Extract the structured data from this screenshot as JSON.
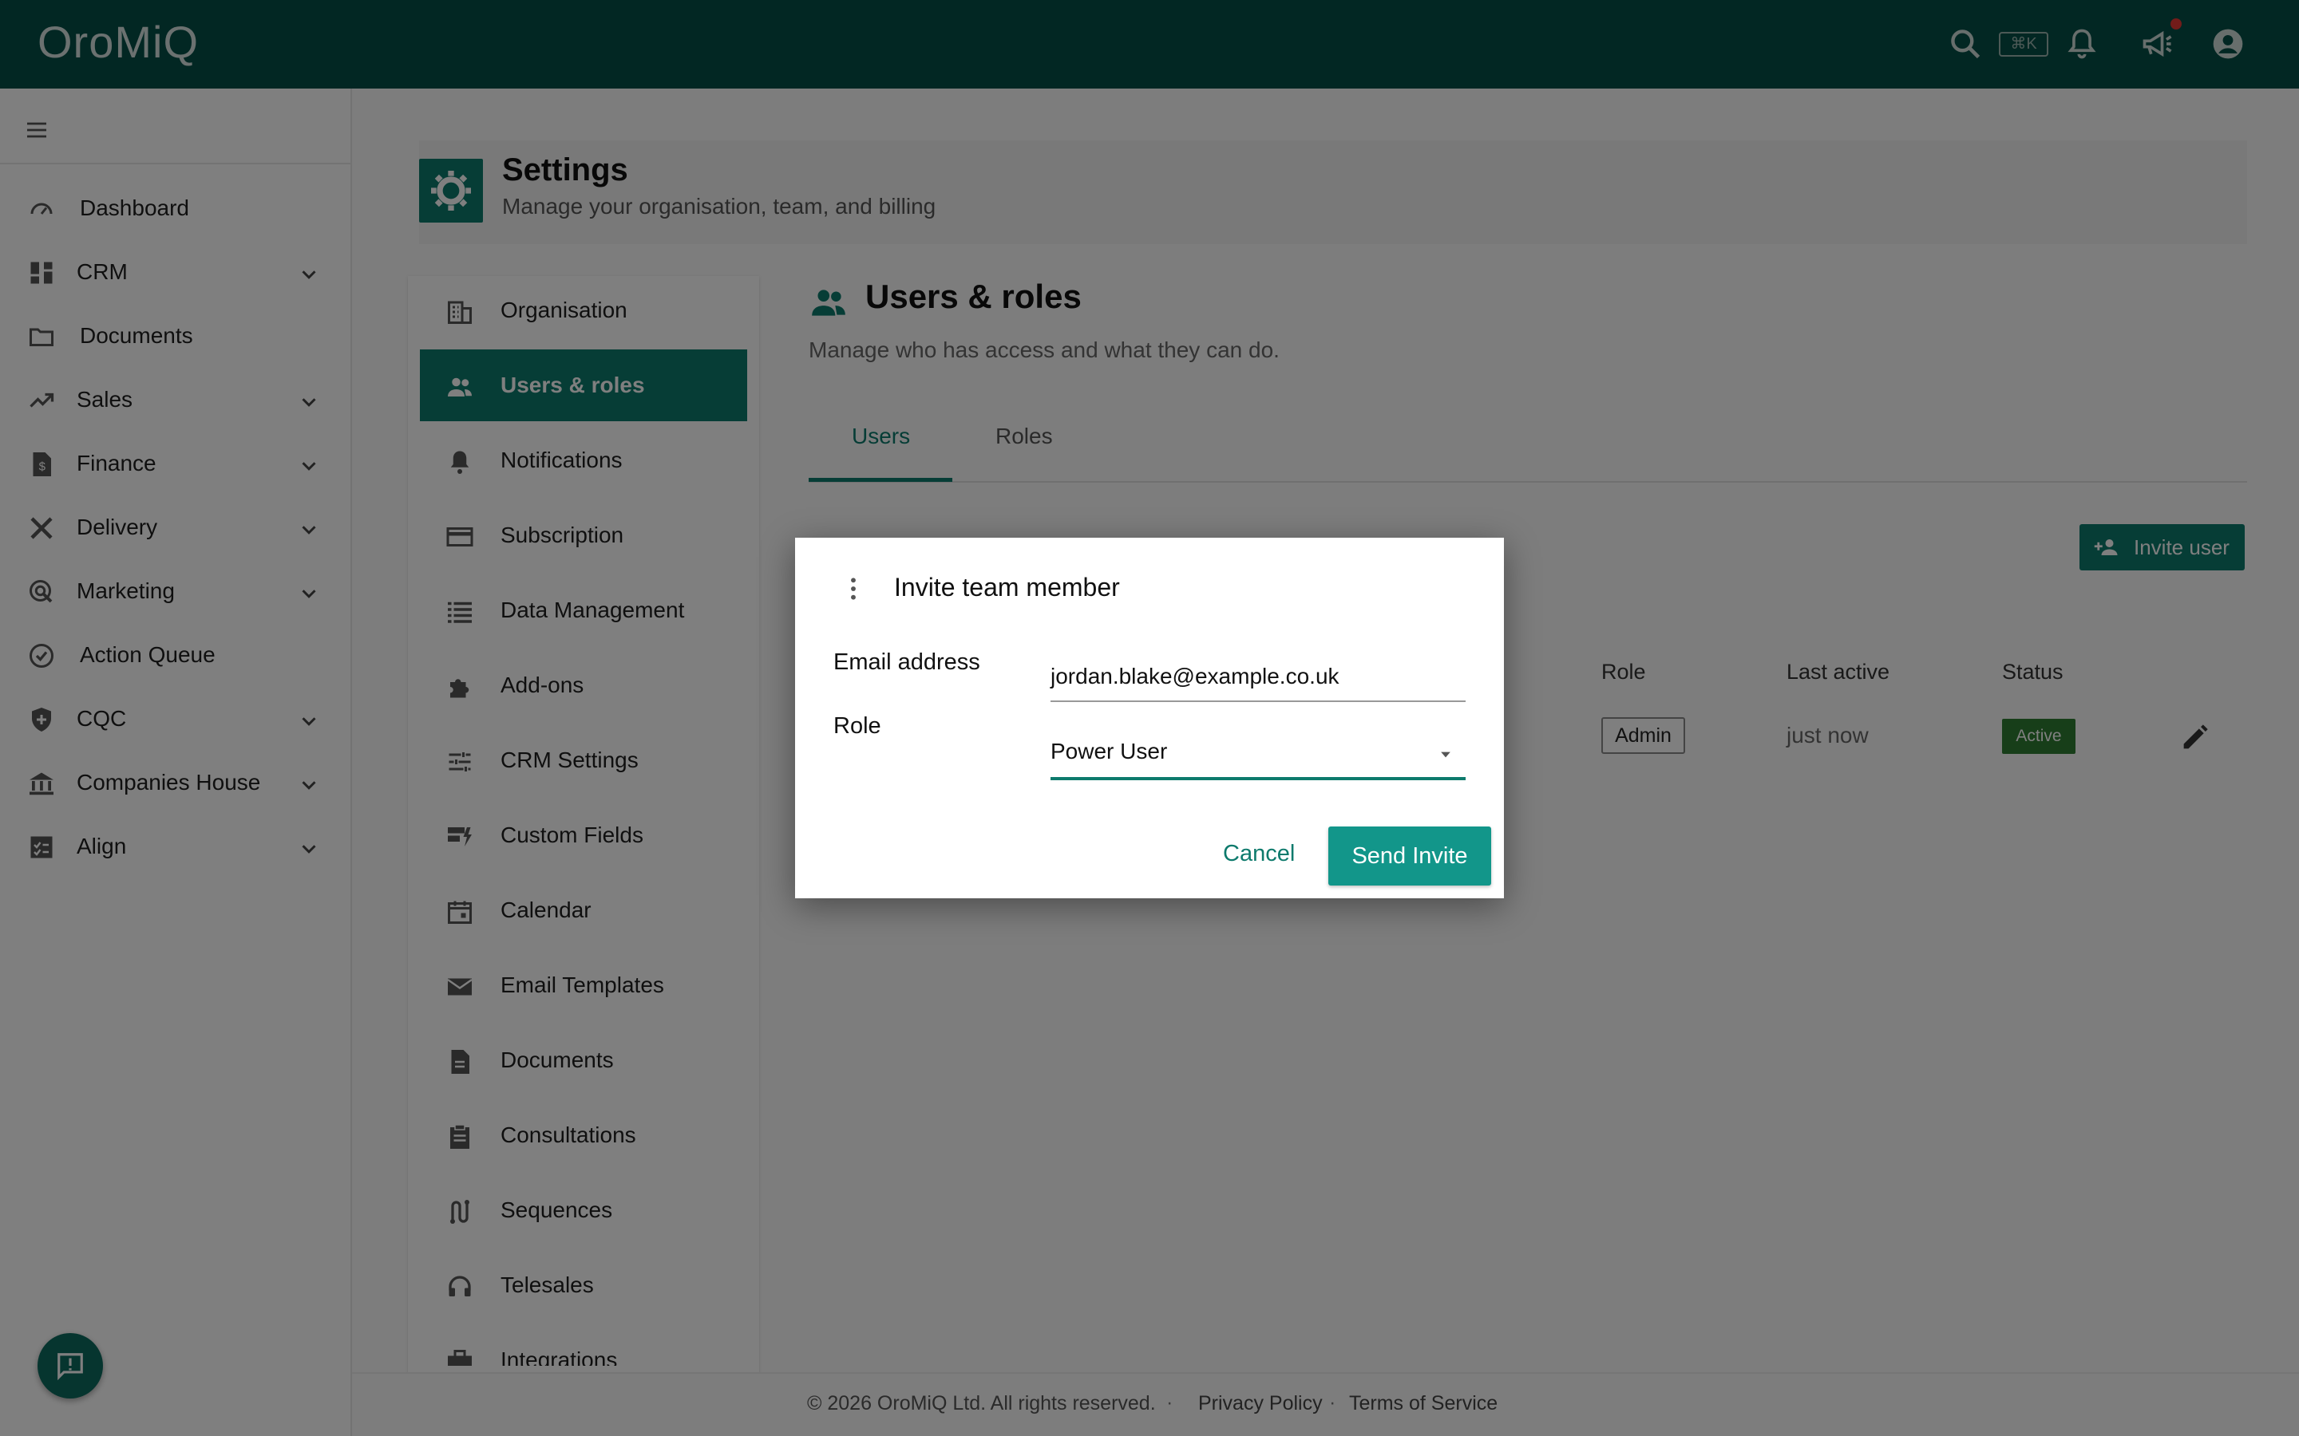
{
  "app": {
    "logo": "OroMiQ",
    "search_shortcut": "⌘K"
  },
  "sidebar": {
    "items": [
      {
        "label": "Dashboard",
        "icon": "speedometer-icon",
        "expandable": false
      },
      {
        "label": "CRM",
        "icon": "dashboard-grid-icon",
        "expandable": true
      },
      {
        "label": "Documents",
        "icon": "folder-icon",
        "expandable": false
      },
      {
        "label": "Sales",
        "icon": "trending-up-icon",
        "expandable": true
      },
      {
        "label": "Finance",
        "icon": "invoice-icon",
        "expandable": true
      },
      {
        "label": "Delivery",
        "icon": "tools-icon",
        "expandable": true
      },
      {
        "label": "Marketing",
        "icon": "target-cursor-icon",
        "expandable": true
      },
      {
        "label": "Action Queue",
        "icon": "check-circle-icon",
        "expandable": false
      },
      {
        "label": "CQC",
        "icon": "shield-icon",
        "expandable": true
      },
      {
        "label": "Companies House",
        "icon": "bank-icon",
        "expandable": true
      },
      {
        "label": "Align",
        "icon": "checklist-icon",
        "expandable": true
      }
    ]
  },
  "settings": {
    "title": "Settings",
    "subtitle": "Manage your organisation, team, and billing"
  },
  "subnav": {
    "items": [
      {
        "label": "Organisation"
      },
      {
        "label": "Users & roles"
      },
      {
        "label": "Notifications"
      },
      {
        "label": "Subscription"
      },
      {
        "label": "Data Management"
      },
      {
        "label": "Add-ons"
      },
      {
        "label": "CRM Settings"
      },
      {
        "label": "Custom Fields"
      },
      {
        "label": "Calendar"
      },
      {
        "label": "Email Templates"
      },
      {
        "label": "Documents"
      },
      {
        "label": "Consultations"
      },
      {
        "label": "Sequences"
      },
      {
        "label": "Telesales"
      },
      {
        "label": "Integrations"
      }
    ]
  },
  "content": {
    "title": "Users & roles",
    "subtitle": "Manage who has access and what they can do.",
    "tabs": [
      {
        "label": "Users"
      },
      {
        "label": "Roles"
      }
    ],
    "invite_button": "Invite user",
    "table": {
      "headers": {
        "role": "Role",
        "last_active": "Last active",
        "status": "Status"
      },
      "row": {
        "role": "Admin",
        "last_active": "just now",
        "status": "Active"
      }
    }
  },
  "dialog": {
    "title": "Invite team member",
    "email_label": "Email address",
    "email_value": "jordan.blake@example.co.uk",
    "role_label": "Role",
    "role_value": "Power User",
    "cancel": "Cancel",
    "send": "Send Invite"
  },
  "footer": {
    "copyright": "© 2026 OroMiQ Ltd. All rights reserved.",
    "privacy": "Privacy Policy",
    "terms": "Terms of Service"
  }
}
